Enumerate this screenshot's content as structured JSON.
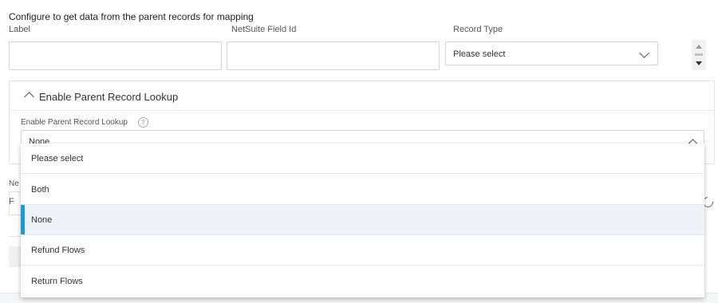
{
  "section": {
    "heading": "Configure to get data from the parent records for mapping"
  },
  "fields": {
    "label": {
      "label": "Label",
      "value": ""
    },
    "netsuite_field_id": {
      "label": "NetSuite Field Id",
      "value": ""
    },
    "record_type": {
      "label": "Record Type",
      "selected": "Please select"
    }
  },
  "panel": {
    "title": "Enable Parent Record Lookup",
    "field_label": "Enable Parent Record Lookup",
    "help_glyph": "?",
    "selected": "None"
  },
  "partial": {
    "label_fragment": "Ne",
    "input_fragment": "F"
  },
  "dropdown": {
    "options": [
      "Please select",
      "Both",
      "None",
      "Refund Flows",
      "Return Flows"
    ],
    "selected_index": 2,
    "accent_color": "#1a9bd7"
  }
}
